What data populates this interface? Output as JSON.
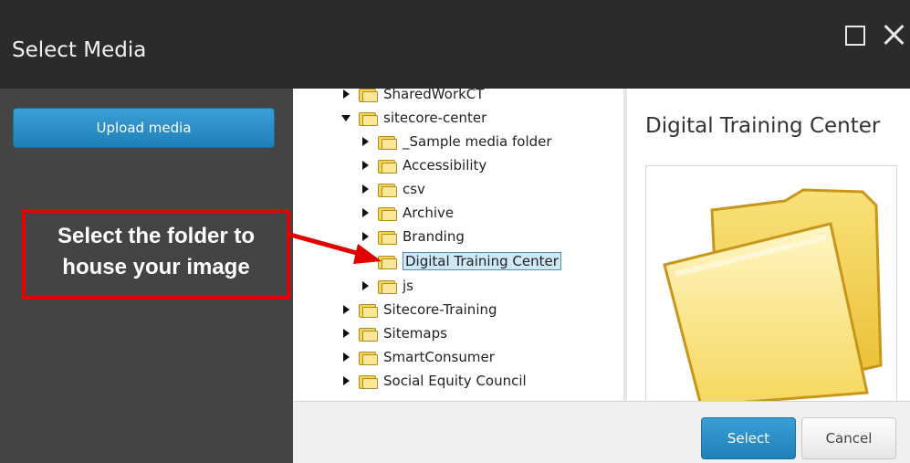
{
  "dialog": {
    "title": "Select Media"
  },
  "left_panel": {
    "upload_label": "Upload media"
  },
  "callout": {
    "line1": "Select the folder to",
    "line2": "house your image"
  },
  "tree": {
    "items": [
      {
        "label": "SharedWorkCT",
        "level": 0,
        "state": "closed"
      },
      {
        "label": "sitecore-center",
        "level": 0,
        "state": "open"
      },
      {
        "label": "_Sample media folder",
        "level": 1,
        "state": "closed"
      },
      {
        "label": "Accessibility",
        "level": 1,
        "state": "closed"
      },
      {
        "label": "csv",
        "level": 1,
        "state": "closed"
      },
      {
        "label": "Archive",
        "level": 1,
        "state": "closed"
      },
      {
        "label": "Branding",
        "level": 1,
        "state": "closed"
      },
      {
        "label": "Digital Training Center",
        "level": 1,
        "state": "none",
        "selected": true
      },
      {
        "label": "js",
        "level": 1,
        "state": "closed"
      },
      {
        "label": "Sitecore-Training",
        "level": 0,
        "state": "closed"
      },
      {
        "label": "Sitemaps",
        "level": 0,
        "state": "closed"
      },
      {
        "label": "SmartConsumer",
        "level": 0,
        "state": "closed"
      },
      {
        "label": "Social Equity Council",
        "level": 0,
        "state": "closed"
      }
    ]
  },
  "preview": {
    "title": "Digital Training Center",
    "icon": "folder-icon"
  },
  "footer": {
    "select_label": "Select",
    "cancel_label": "Cancel"
  },
  "colors": {
    "accent": "#1f80b8",
    "callout_border": "#e00000",
    "titlebar": "#2b2b2b",
    "left_panel": "#444444"
  }
}
